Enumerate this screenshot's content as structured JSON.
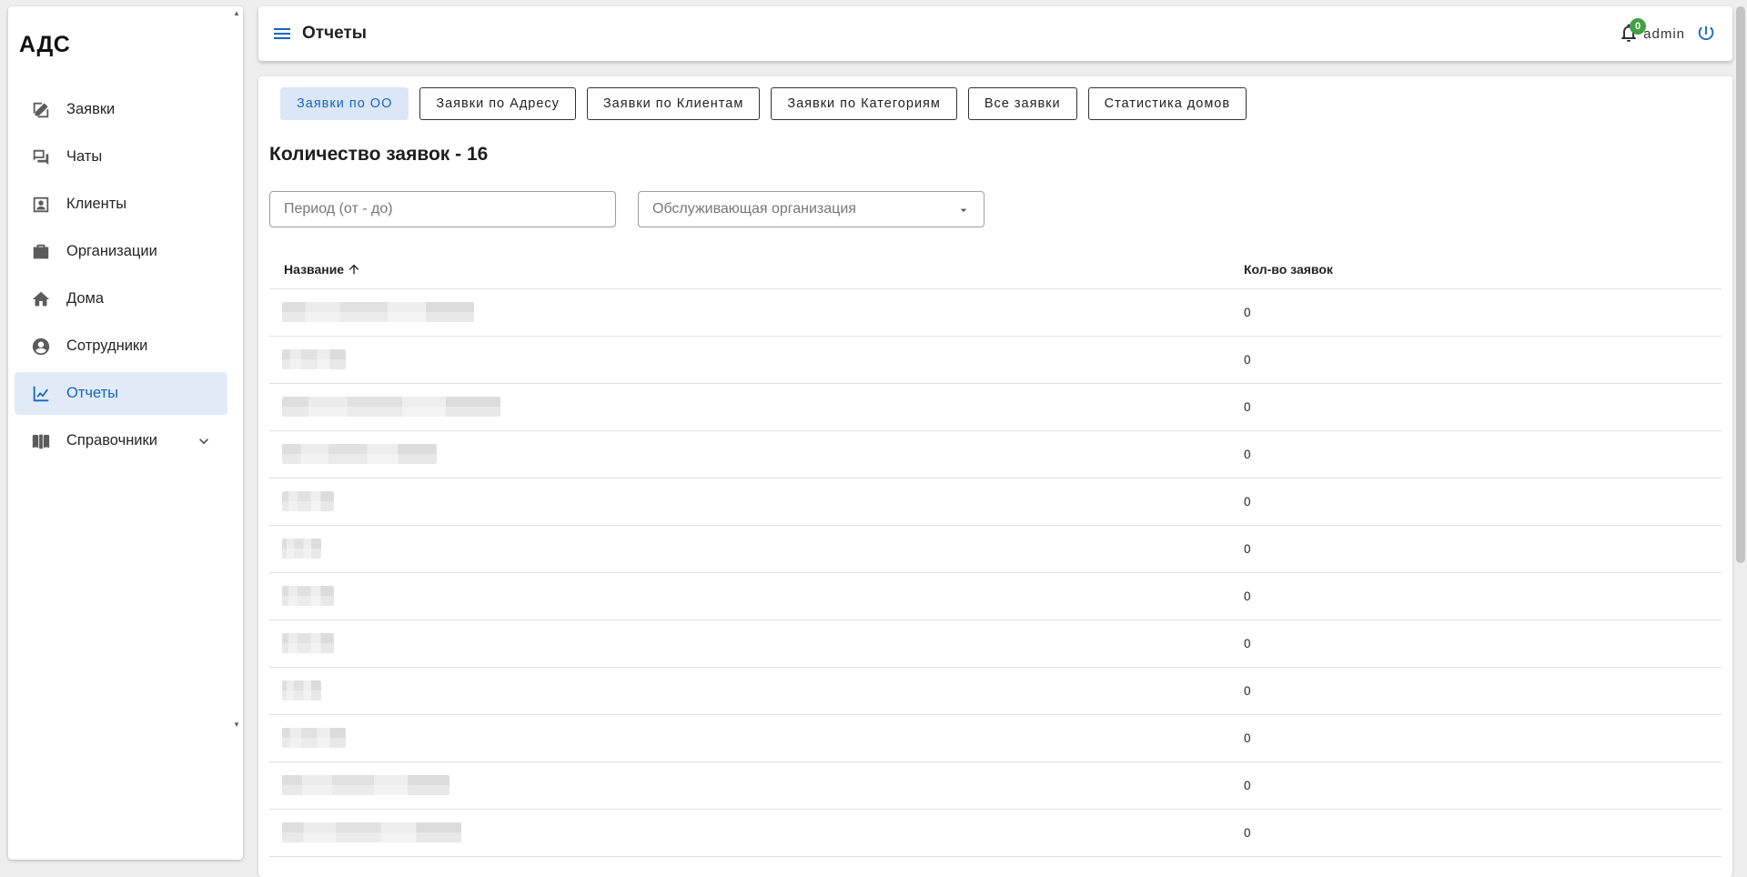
{
  "app": {
    "title": "АДС"
  },
  "sidebar": {
    "items": [
      {
        "label": "Заявки",
        "icon": "edit-icon",
        "active": false
      },
      {
        "label": "Чаты",
        "icon": "chat-icon",
        "active": false
      },
      {
        "label": "Клиенты",
        "icon": "contact-card-icon",
        "active": false
      },
      {
        "label": "Организации",
        "icon": "briefcase-icon",
        "active": false
      },
      {
        "label": "Дома",
        "icon": "home-icon",
        "active": false
      },
      {
        "label": "Сотрудники",
        "icon": "account-circle-icon",
        "active": false
      },
      {
        "label": "Отчеты",
        "icon": "chart-line-icon",
        "active": true
      },
      {
        "label": "Справочники",
        "icon": "book-icon",
        "active": false,
        "expandable": true
      }
    ]
  },
  "header": {
    "title": "Отчеты",
    "notifications_count": "0",
    "user": "admin"
  },
  "tabs": [
    {
      "label": "Заявки по ОО",
      "active": true
    },
    {
      "label": "Заявки по Адресу",
      "active": false
    },
    {
      "label": "Заявки по Клиентам",
      "active": false
    },
    {
      "label": "Заявки по Категориям",
      "active": false
    },
    {
      "label": "Все заявки",
      "active": false
    },
    {
      "label": "Статистика домов",
      "active": false
    }
  ],
  "report": {
    "count_title": "Количество заявок - 16",
    "period_placeholder": "Период (от - до)",
    "org_placeholder": "Обслуживающая организация"
  },
  "table": {
    "columns": {
      "name": "Название",
      "count": "Кол-во заявок"
    },
    "rows": [
      {
        "count": "0",
        "name_redacted_fraction": 0.78
      },
      {
        "count": "0",
        "name_redacted_fraction": 0.26
      },
      {
        "count": "0",
        "name_redacted_fraction": 0.89
      },
      {
        "count": "0",
        "name_redacted_fraction": 0.63
      },
      {
        "count": "0",
        "name_redacted_fraction": 0.21
      },
      {
        "count": "0",
        "name_redacted_fraction": 0.16
      },
      {
        "count": "0",
        "name_redacted_fraction": 0.21
      },
      {
        "count": "0",
        "name_redacted_fraction": 0.21
      },
      {
        "count": "0",
        "name_redacted_fraction": 0.16
      },
      {
        "count": "0",
        "name_redacted_fraction": 0.26
      },
      {
        "count": "0",
        "name_redacted_fraction": 0.68
      },
      {
        "count": "0",
        "name_redacted_fraction": 0.73
      }
    ]
  },
  "colors": {
    "accent": "#1565c0",
    "active_bg": "#e1ebf7",
    "badge": "#43a047"
  }
}
